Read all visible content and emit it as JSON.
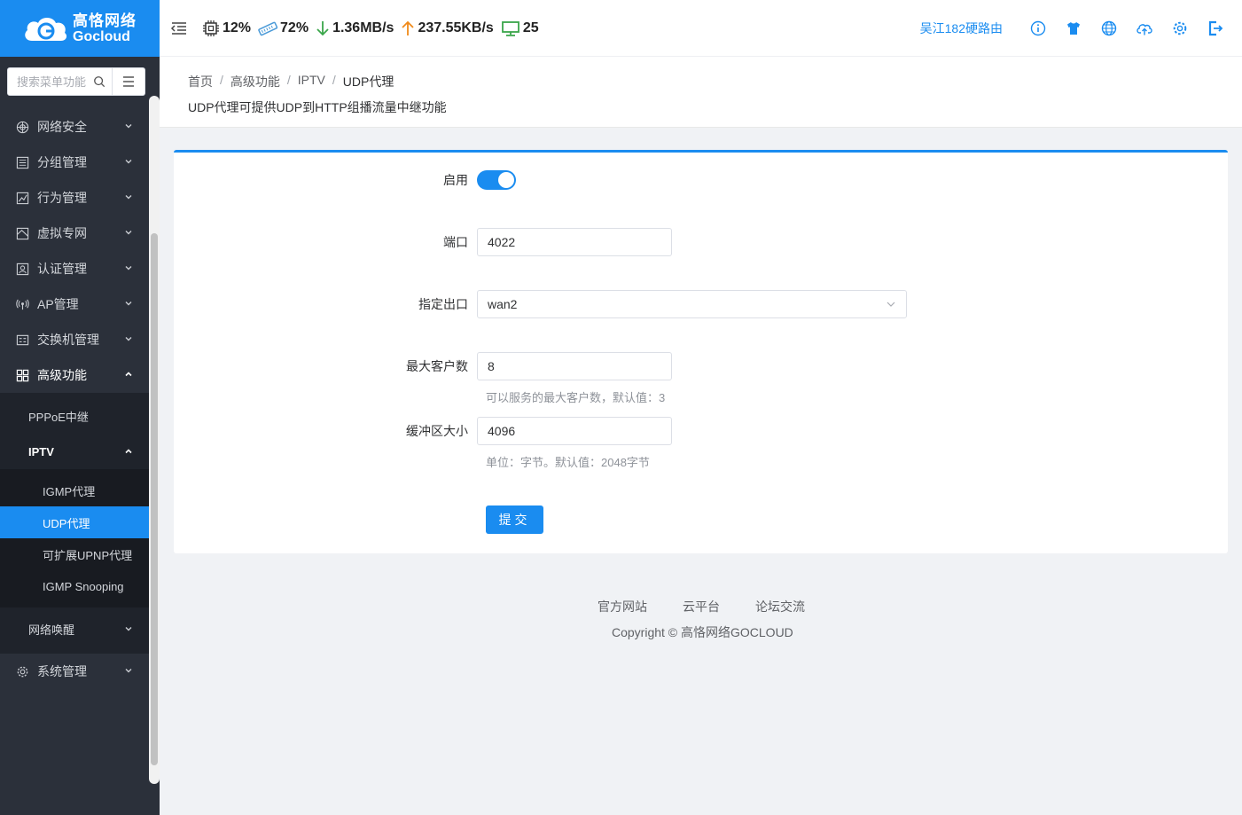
{
  "brand": {
    "name_cn": "高恪网络",
    "name_en": "Gocloud"
  },
  "sidebar": {
    "search_placeholder": "搜索菜单功能",
    "items": [
      {
        "label": "网络安全",
        "icon": "globe-shield-icon"
      },
      {
        "label": "分组管理",
        "icon": "list-icon"
      },
      {
        "label": "行为管理",
        "icon": "chart-icon"
      },
      {
        "label": "虚拟专网",
        "icon": "vpn-icon"
      },
      {
        "label": "认证管理",
        "icon": "user-card-icon"
      },
      {
        "label": "AP管理",
        "icon": "wifi-ap-icon"
      },
      {
        "label": "交换机管理",
        "icon": "switch-icon"
      },
      {
        "label": "高级功能",
        "icon": "grid-icon"
      }
    ],
    "advanced_sub": {
      "pppoe": "PPPoE中继",
      "iptv": "IPTV",
      "iptv_items": [
        "IGMP代理",
        "UDP代理",
        "可扩展UPNP代理",
        "IGMP Snooping"
      ],
      "wake": "网络唤醒"
    },
    "system": "系统管理"
  },
  "header": {
    "cpu": "12%",
    "mem": "72%",
    "down": "1.36MB/s",
    "up": "237.55KB/s",
    "devices": "25",
    "device_name": "吴江182硬路由"
  },
  "breadcrumb": [
    "首页",
    "高级功能",
    "IPTV",
    "UDP代理"
  ],
  "page_desc": "UDP代理可提供UDP到HTTP组播流量中继功能",
  "form": {
    "enable_label": "启用",
    "port_label": "端口",
    "port_value": "4022",
    "exit_label": "指定出口",
    "exit_value": "wan2",
    "max_label": "最大客户数",
    "max_value": "8",
    "max_hint": "可以服务的最大客户数，默认值：3",
    "buf_label": "缓冲区大小",
    "buf_value": "4096",
    "buf_hint": "单位：字节。默认值：2048字节",
    "submit": "提交"
  },
  "footer": {
    "links": [
      "官方网站",
      "云平台",
      "论坛交流"
    ],
    "copyright": "Copyright © 高恪网络GOCLOUD"
  },
  "colors": {
    "accent": "#1a8cf0",
    "sidebar": "#2b303a"
  }
}
